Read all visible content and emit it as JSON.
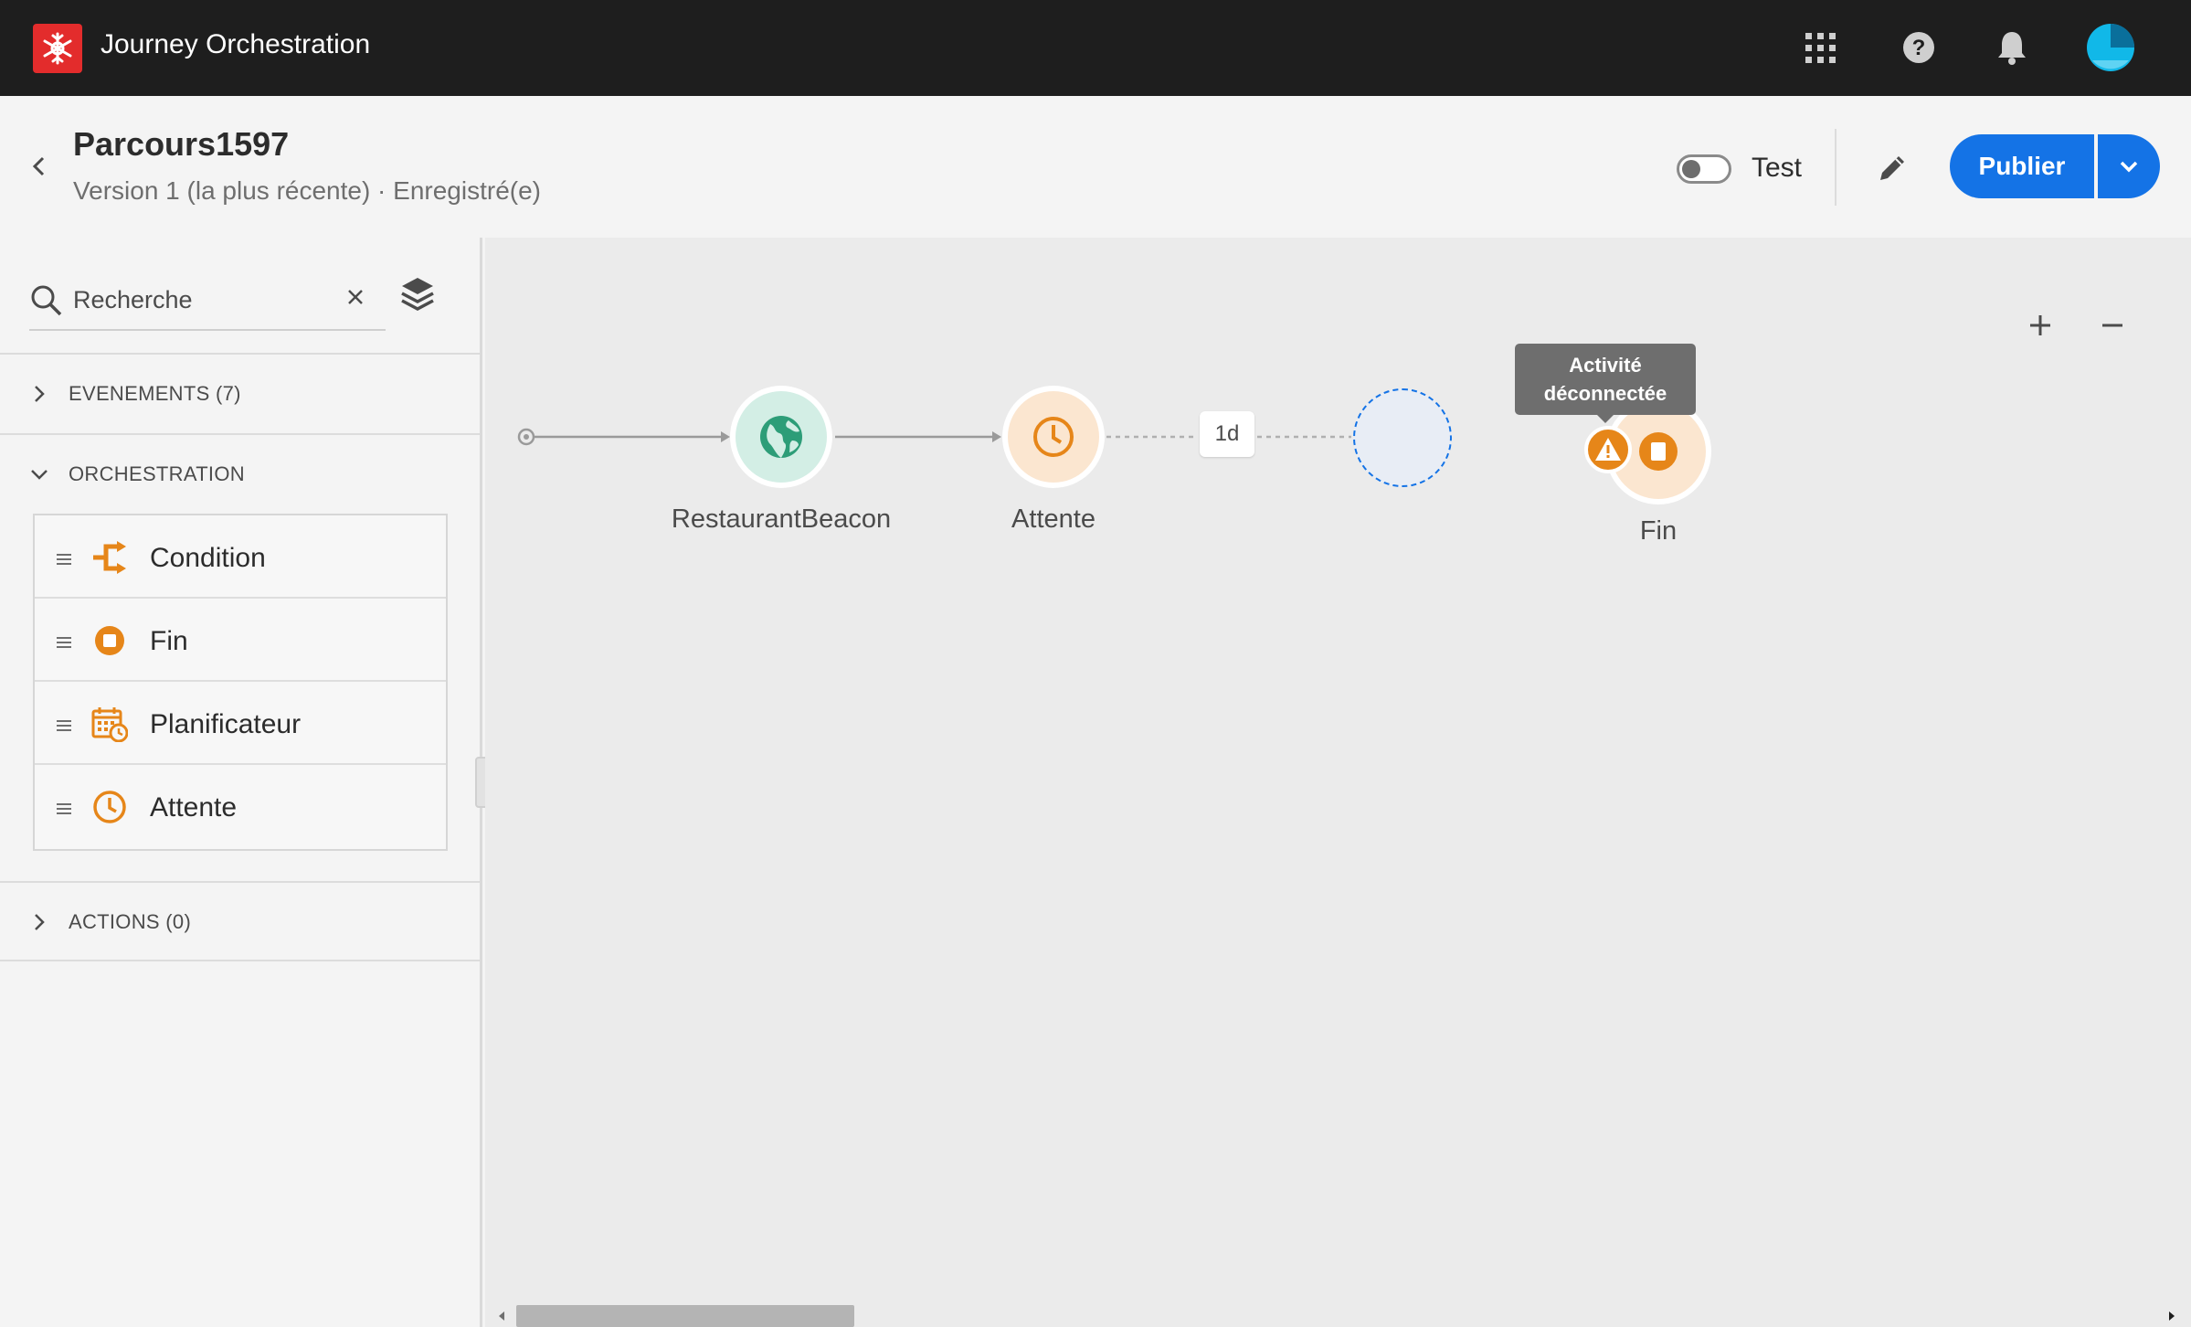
{
  "app": {
    "title": "Journey Orchestration"
  },
  "topbar": {
    "icons": [
      "apps-grid-icon",
      "help-icon",
      "bell-icon",
      "avatar"
    ]
  },
  "header": {
    "title": "Parcours1597",
    "subtitle": "Version 1 (la plus récente) · Enregistré(e)",
    "test_label": "Test",
    "test_toggle_on": false,
    "publish_label": "Publier"
  },
  "sidebar": {
    "search_placeholder": "Recherche",
    "sections": {
      "events": {
        "label": "EVENEMENTS (7)",
        "expanded": false
      },
      "orchestration": {
        "label": "ORCHESTRATION",
        "expanded": true
      },
      "actions": {
        "label": "ACTIONS (0)",
        "expanded": false
      }
    },
    "orchestration_items": [
      {
        "label": "Condition",
        "icon": "condition-icon"
      },
      {
        "label": "Fin",
        "icon": "end-icon"
      },
      {
        "label": "Planificateur",
        "icon": "scheduler-icon"
      },
      {
        "label": "Attente",
        "icon": "clock-icon"
      }
    ]
  },
  "canvas": {
    "nodes": [
      {
        "label": "RestaurantBeacon",
        "type": "event",
        "icon": "globe-icon"
      },
      {
        "label": "Attente",
        "type": "wait",
        "icon": "clock-icon"
      },
      {
        "label": "",
        "type": "placeholder"
      },
      {
        "label": "Fin",
        "type": "end",
        "icon": "stop-icon"
      }
    ],
    "wait_duration": "1d",
    "tooltip": {
      "line1": "Activité",
      "line2": "déconnectée"
    }
  },
  "colors": {
    "topbar": "#1e1e1e",
    "brand_red": "#e32c2c",
    "accent_blue": "#1473e6",
    "orange": "#e68619",
    "green": "#2d9d78"
  }
}
